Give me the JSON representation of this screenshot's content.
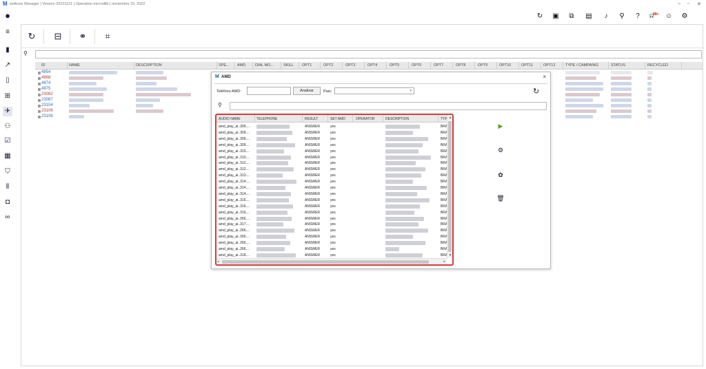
{
  "app": {
    "title": "wolkvox Manager | Version 20221121 | Operation microdilb | noviembre 23, 2022",
    "window_controls": [
      "–",
      "▫",
      "✕"
    ]
  },
  "topbar": {
    "icons": [
      "refresh-icon",
      "briefcase-icon",
      "contacts-book-icon",
      "id-card-icon",
      "music-note-icon",
      "microphone-icon",
      "help-icon",
      "bell-icon",
      "user-icon",
      "gear-icon"
    ],
    "notification_badge": "99+"
  },
  "sidebar": {
    "icons": [
      "user-avatar-icon",
      "menu-icon",
      "bar-chart-icon",
      "trend-icon",
      "document-icon",
      "org-chart-icon",
      "campaign-icon",
      "team-icon",
      "checklist-icon",
      "list-icon",
      "shield-icon",
      "audio-wave-icon",
      "video-icon",
      "voicemail-icon"
    ]
  },
  "toolbar": {
    "icons": [
      "refresh-icon",
      "add-list-icon",
      "handshake-icon",
      "chip-icon"
    ]
  },
  "grid": {
    "columns": [
      "ID",
      "NAME",
      "DESCRIPTION",
      "SPE...",
      "AMD",
      "DIAL MO...",
      "SKILL",
      "OPT1",
      "OPT2",
      "OPT3",
      "OPT4",
      "OPT5",
      "OPT6",
      "OPT7",
      "OPT8",
      "OPT9",
      "OPT10",
      "OPT11",
      "OPT12",
      "TYPE / CAMPAING",
      "STATUS",
      "RECYCLED"
    ],
    "rows": [
      {
        "id": "4854",
        "color": "blue"
      },
      {
        "id": "4868",
        "color": "red"
      },
      {
        "id": "4874",
        "color": "blue"
      },
      {
        "id": "4875",
        "color": "blue"
      },
      {
        "id": "23082",
        "color": "red"
      },
      {
        "id": "23087",
        "color": "blue"
      },
      {
        "id": "23104",
        "color": "blue"
      },
      {
        "id": "23106",
        "color": "red"
      },
      {
        "id": "23108",
        "color": "blue"
      }
    ]
  },
  "dialog": {
    "title": "AMD",
    "close": "×",
    "telefono_label": "Teléfono AMD:",
    "analizar_label": "Analizar",
    "pais_label": "Pais:",
    "table": {
      "columns": [
        "AUDIO NAME",
        "TELEPHONE",
        "RESULT",
        "SET AMD",
        "OPERATOR",
        "DESCRIPTION",
        "TYP"
      ],
      "rows": [
        {
          "audio": "amd_play_ai..309....",
          "result": "ANSWER",
          "set_amd": "yes",
          "typ": "BRA"
        },
        {
          "audio": "amd_play_ai..309....",
          "result": "ANSWER",
          "set_amd": "yes",
          "typ": "BRA"
        },
        {
          "audio": "amd_play_ai..309....",
          "result": "ANSWER",
          "set_amd": "yes",
          "typ": "BRA"
        },
        {
          "audio": "amd_play_ai..309....",
          "result": "ANSWER",
          "set_amd": "yes",
          "typ": "BRA"
        },
        {
          "audio": "amd_play_ai..310....",
          "result": "ANSWER",
          "set_amd": "yes",
          "typ": "BRA"
        },
        {
          "audio": "amd_play_ai..310....",
          "result": "ANSWER",
          "set_amd": "yes",
          "typ": "BRA"
        },
        {
          "audio": "amd_play_ai..312....",
          "result": "ANSWER",
          "set_amd": "yes",
          "typ": "BRA"
        },
        {
          "audio": "amd_play_ai..312....",
          "result": "ANSWER",
          "set_amd": "yes",
          "typ": "BRA"
        },
        {
          "audio": "amd_play_ai..313....",
          "result": "ANSWER",
          "set_amd": "yes",
          "typ": "BRA"
        },
        {
          "audio": "amd_play_ai..314....",
          "result": "ANSWER",
          "set_amd": "yes",
          "typ": "BRA"
        },
        {
          "audio": "amd_play_ai..314....",
          "result": "ANSWER",
          "set_amd": "yes",
          "typ": "BRA"
        },
        {
          "audio": "amd_play_ai..314....",
          "result": "ANSWER",
          "set_amd": "yes",
          "typ": "BRA"
        },
        {
          "audio": "amd_play_ai..316....",
          "result": "ANSWER",
          "set_amd": "yes",
          "typ": "BRA"
        },
        {
          "audio": "amd_play_ai..316....",
          "result": "ANSWER",
          "set_amd": "yes",
          "typ": "BRA"
        },
        {
          "audio": "amd_play_ai..316....",
          "result": "ANSWER",
          "set_amd": "yes",
          "typ": "BRA"
        },
        {
          "audio": "amd_play_ai..266....",
          "result": "ANSWER",
          "set_amd": "yes",
          "typ": "BRA"
        },
        {
          "audio": "amd_play_ai..317....",
          "result": "ANSWER",
          "set_amd": "yes",
          "typ": "BRA"
        },
        {
          "audio": "amd_play_ai..266....",
          "result": "ANSWER",
          "set_amd": "yes",
          "typ": "BRA"
        },
        {
          "audio": "amd_play_ai..266....",
          "result": "ANSWER",
          "set_amd": "yes",
          "typ": "BRA"
        },
        {
          "audio": "amd_play_ai..266....",
          "result": "ANSWER",
          "set_amd": "yes",
          "typ": "BRA"
        },
        {
          "audio": "amd_play_ai..266....",
          "result": "ANSWER",
          "set_amd": "yes",
          "typ": "BRA"
        },
        {
          "audio": "amd_play_ai..318....",
          "result": "ANSWER",
          "set_amd": "yes",
          "typ": "BRA"
        }
      ]
    },
    "side_actions": [
      "play-icon",
      "settings-cog-icon",
      "brain-icon",
      "trash-icon"
    ]
  },
  "colors": {
    "accent_blue": "#2a6fb5",
    "id_red": "#b23a3a",
    "highlight_border": "#d23b3b",
    "play_green": "#5aa02c"
  }
}
